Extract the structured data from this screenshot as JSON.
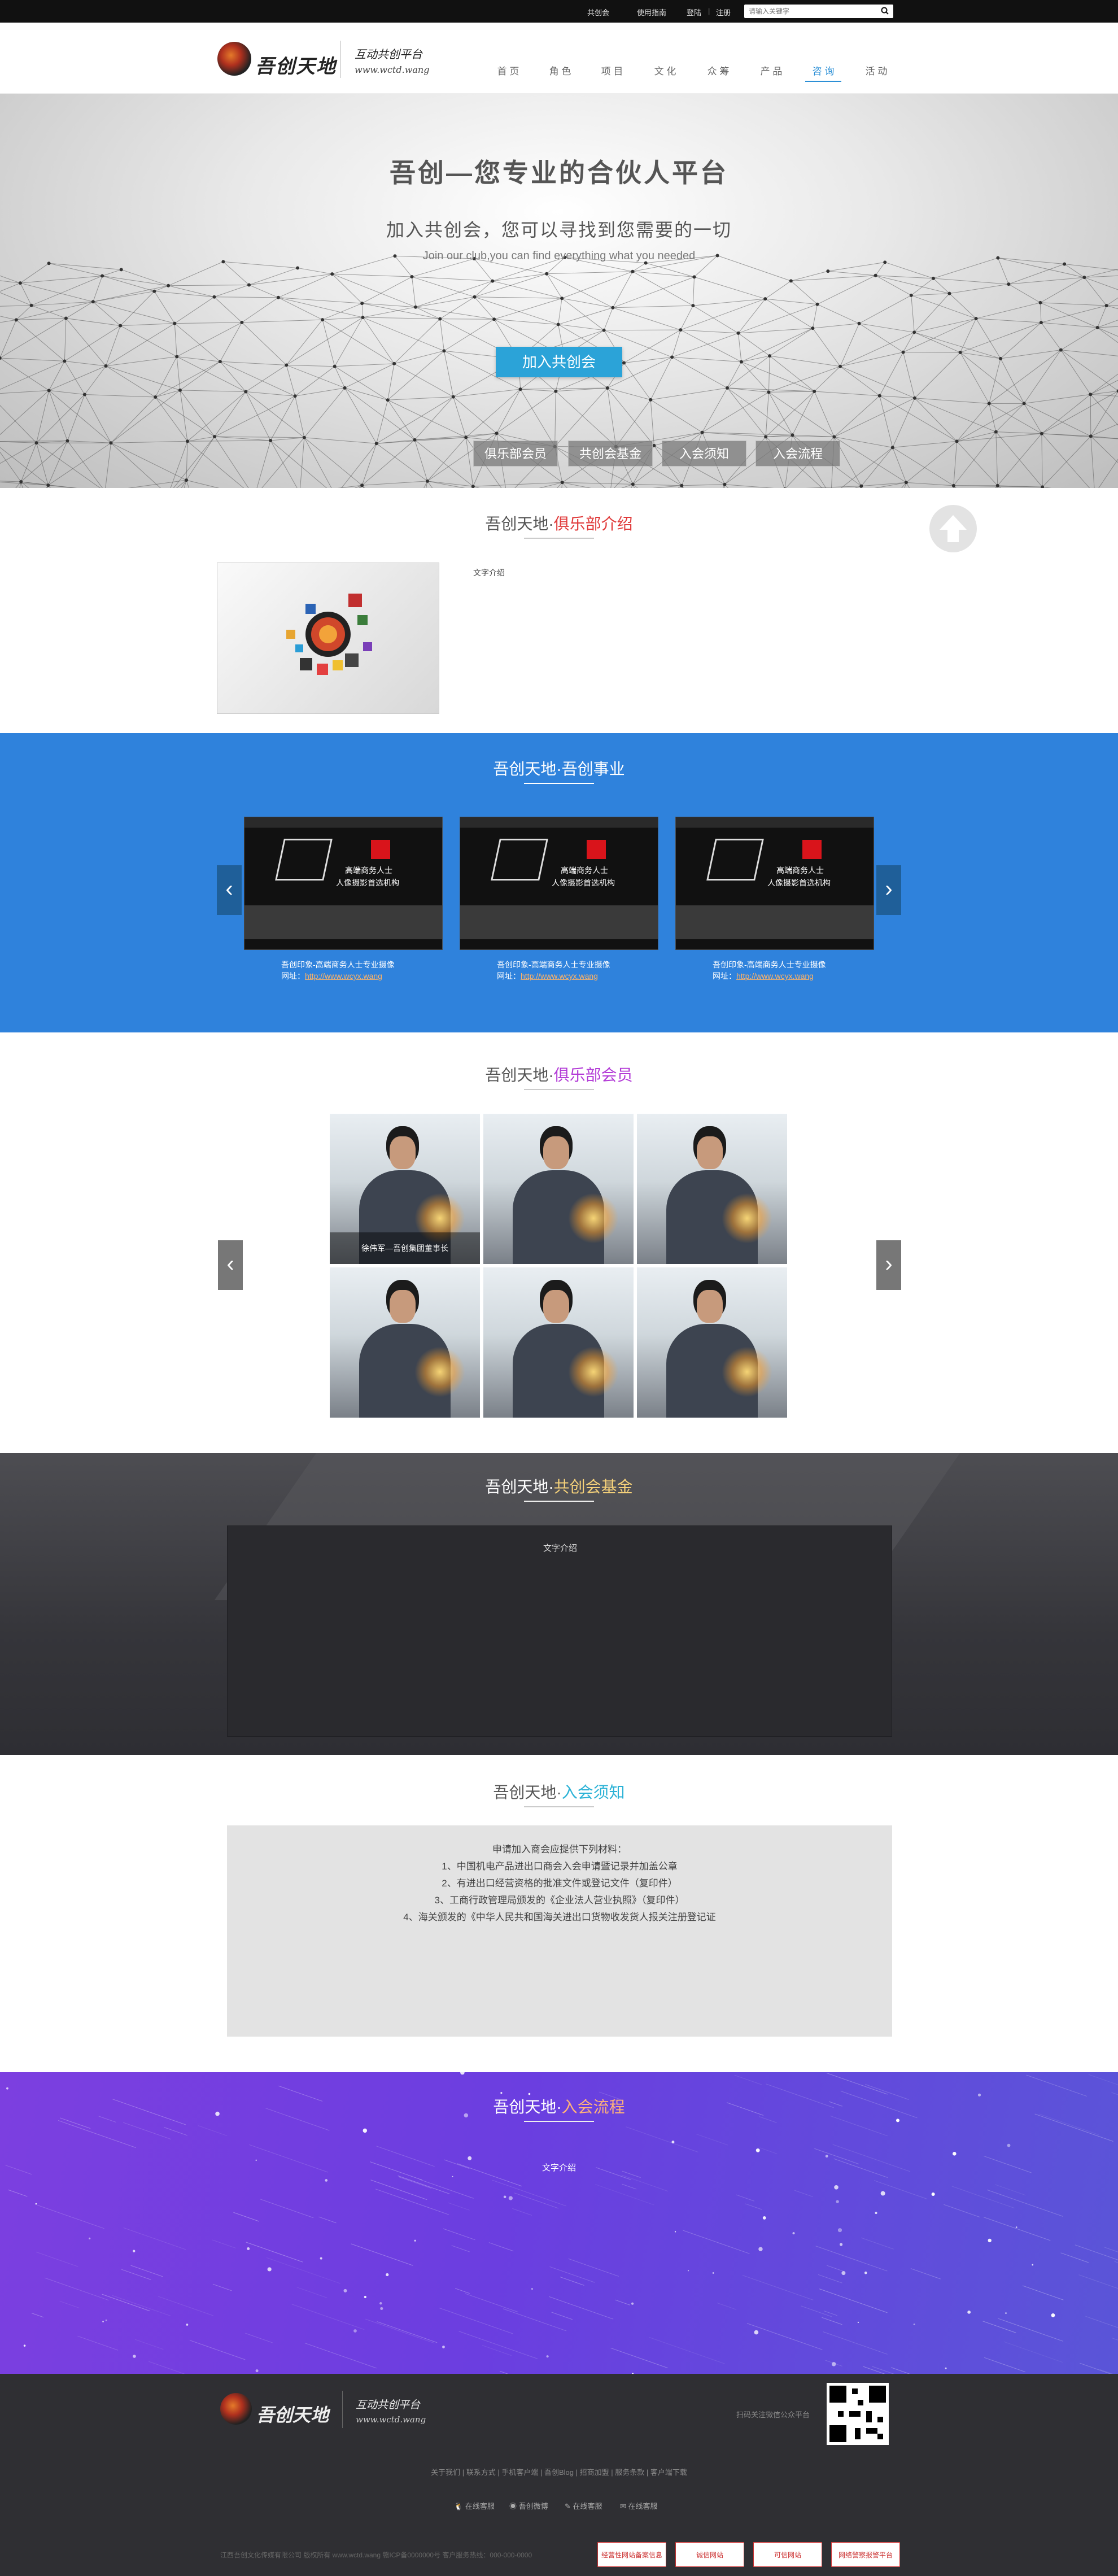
{
  "topbar": {
    "links": [
      "共创会",
      "使用指南",
      "登陆",
      "|",
      "注册"
    ],
    "search_placeholder": "请输入关键字"
  },
  "header": {
    "logo_text": "吾创天地",
    "slogan": "互动共创平台",
    "slogan_url": "www.wctd.wang",
    "nav": [
      "首 页",
      "角 色",
      "项 目",
      "文 化",
      "众 筹",
      "产 品",
      "咨 询",
      "活 动"
    ],
    "active_nav": "咨 询"
  },
  "hero": {
    "title": "吾创—您专业的合伙人平台",
    "subtitle": "加入共创会，您可以寻找到您需要的一切",
    "subtitle_en": "Join our club,you can find everything what you needed",
    "join_button": "加入共创会",
    "tabs": [
      "俱乐部会员",
      "共创会基金",
      "入会须知",
      "入会流程"
    ]
  },
  "intro": {
    "title_prefix": "吾创天地·",
    "title_highlight": "俱乐部介绍",
    "text": "文字介绍"
  },
  "business": {
    "title_prefix": "吾创天地·",
    "title_highlight": "吾创事业",
    "cards": [
      {
        "caption": "吾创印象-高端商务人士专业摄像",
        "url_label": "网址：",
        "url": "http://www.wcyx.wang",
        "shot_line1": "高端商务人士",
        "shot_line2": "人像摄影首选机构"
      },
      {
        "caption": "吾创印象-高端商务人士专业摄像",
        "url_label": "网址：",
        "url": "http://www.wcyx.wang",
        "shot_line1": "高端商务人士",
        "shot_line2": "人像摄影首选机构"
      },
      {
        "caption": "吾创印象-高端商务人士专业摄像",
        "url_label": "网址：",
        "url": "http://www.wcyx.wang",
        "shot_line1": "高端商务人士",
        "shot_line2": "人像摄影首选机构"
      }
    ],
    "prev": "‹",
    "next": "›"
  },
  "members": {
    "title_prefix": "吾创天地·",
    "title_highlight": "俱乐部会员",
    "first_caption": "徐伟军—吾创集团董事长",
    "prev": "‹",
    "next": "›"
  },
  "fund": {
    "title_prefix": "吾创天地·",
    "title_highlight": "共创会基金",
    "text": "文字介绍"
  },
  "notice": {
    "title_prefix": "吾创天地·",
    "title_highlight": "入会须知",
    "lines": [
      "申请加入商会应提供下列材料：",
      "1、中国机电产品进出口商会入会申请暨记录并加盖公章",
      "2、有进出口经营资格的批准文件或登记文件（复印件）",
      "3、工商行政管理局颁发的《企业法人营业执照》（复印件）",
      "4、海关颁发的《中华人民共和国海关进出口货物收发货人报关注册登记证"
    ]
  },
  "process": {
    "title_prefix": "吾创天地·",
    "title_highlight": "入会流程",
    "text": "文字介绍"
  },
  "footer": {
    "logo_text": "吾创天地",
    "slogan": "互动共创平台",
    "slogan_url": "www.wctd.wang",
    "qr_hint": "扫码关注微信公众平台",
    "links": [
      "关于我们",
      "联系方式",
      "手机客户端",
      "吾创Blog",
      "招商加盟",
      "服务条款",
      "客户端下载"
    ],
    "socials": [
      "在线客服",
      "吾创微博",
      "在线客服",
      "在线客服"
    ],
    "copyright": "江西吾创文化传媒有限公司 版权所有 www.wctd.wang 赣ICP备0000000号  客户服务热线：000-000-0000",
    "badges": [
      "经营性网站备案信息",
      "诚信网站",
      "可信网站",
      "网络警察报警平台"
    ]
  },
  "colors": {
    "primary_blue": "#2f82dc",
    "cta_blue": "#2ba3d8",
    "highlight_red": "#e03b3b",
    "topbar": "#111111",
    "footer": "#2f2f33"
  }
}
